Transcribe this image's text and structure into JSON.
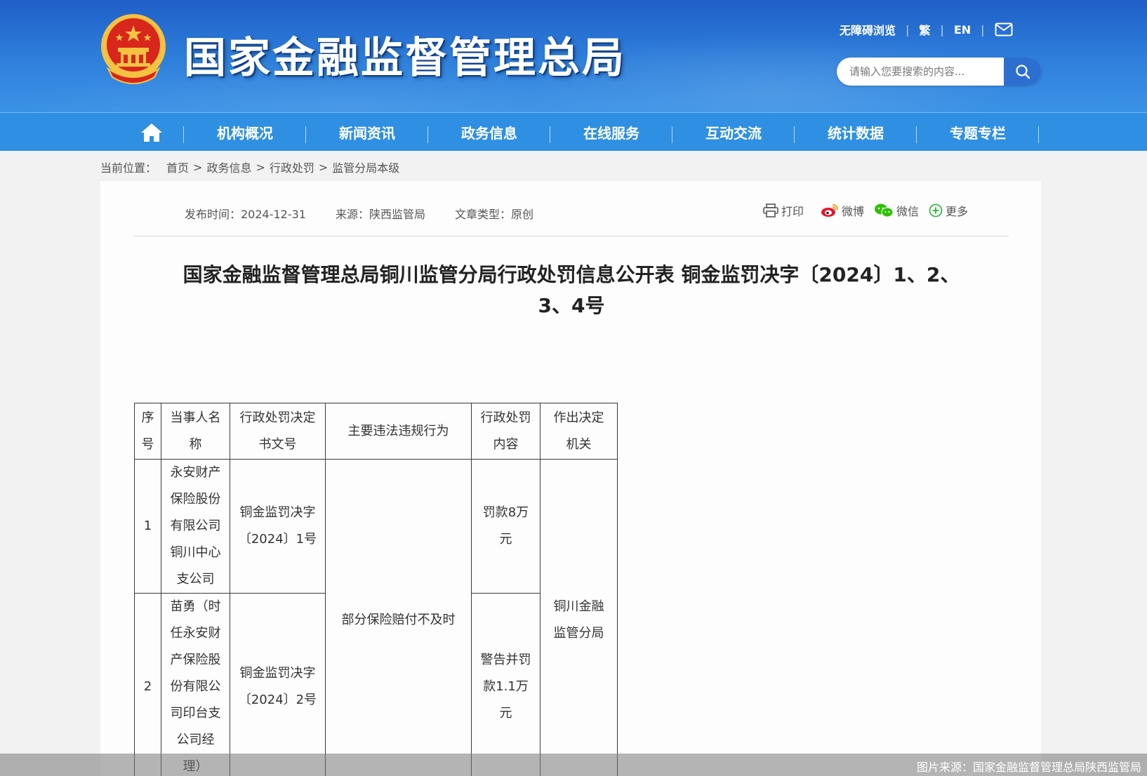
{
  "header": {
    "site_title": "国家金融监督管理总局",
    "top_links": {
      "accessibility": "无障碍浏览",
      "traditional": "繁",
      "english": "EN"
    },
    "search": {
      "placeholder": "请输入您要搜索的内容..."
    },
    "colors": {
      "header_blue": "#2f80dc",
      "nav_blue": "#2f8fe2",
      "emblem_red": "#d8261c",
      "emblem_gold": "#f5c242"
    }
  },
  "nav": {
    "items": [
      {
        "label": "机构概况"
      },
      {
        "label": "新闻资讯"
      },
      {
        "label": "政务信息"
      },
      {
        "label": "在线服务"
      },
      {
        "label": "互动交流"
      },
      {
        "label": "统计数据"
      },
      {
        "label": "专题专栏"
      }
    ]
  },
  "breadcrumb": {
    "label": "当前位置：",
    "items": [
      "首页",
      "政务信息",
      "行政处罚",
      "监管分局本级"
    ],
    "separator": ">"
  },
  "article": {
    "meta": {
      "publish_time": "发布时间：2024-12-31",
      "source": "来源：陕西监管局",
      "type": "文章类型：原创"
    },
    "share": {
      "print": "打印",
      "weibo": "微博",
      "wechat": "微信",
      "more": "更多"
    },
    "title_line1": "国家金融监督管理总局铜川监管分局行政处罚信息公开表 铜金监罚决字〔2024〕1、2、",
    "title_line2": "3、4号"
  },
  "table": {
    "headers": [
      "序号",
      "当事人名称",
      "行政处罚决定书文号",
      "主要违法违规行为",
      "行政处罚内容",
      "作出决定机关"
    ],
    "rows": [
      {
        "no": "1",
        "party": "永安财产保险股份有限公司铜川中心支公司",
        "doc_no": "铜金监罚决字〔2024〕1号",
        "penalty": "罚款8万元"
      },
      {
        "no": "2",
        "party": "苗勇（时任永安财产保险股份有限公司印台支公司经理）",
        "doc_no": "铜金监罚决字〔2024〕2号",
        "penalty": "警告并罚款1.1万元"
      }
    ],
    "violation": "部分保险赔付不及时",
    "authority": "铜川金融监管分局"
  },
  "footer": {
    "credit": "图片来源：国家金融监督管理总局陕西监管局"
  }
}
